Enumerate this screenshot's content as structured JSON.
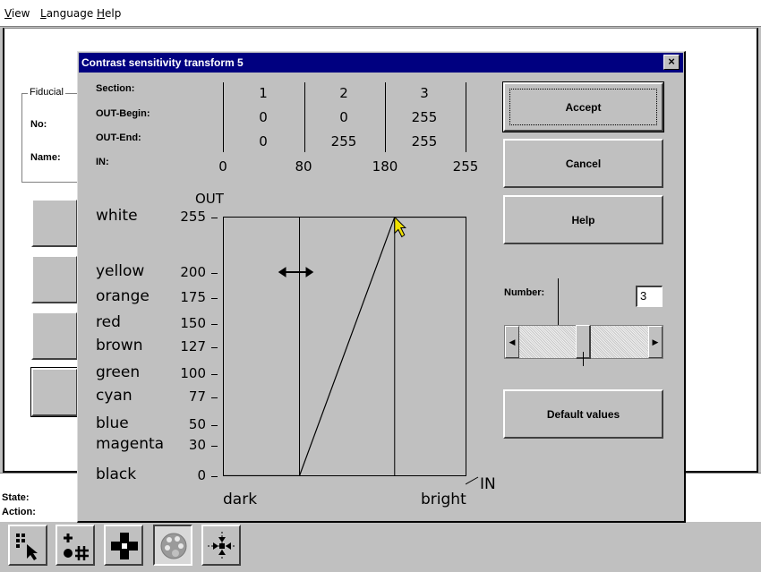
{
  "menubar": {
    "items": [
      {
        "label": "View",
        "ul": "V",
        "rest": "iew"
      },
      {
        "label": "Language",
        "ul": "L",
        "rest": "anguage"
      },
      {
        "label": "Help",
        "ul": "H",
        "rest": "elp"
      }
    ]
  },
  "background": {
    "fiducial_title": "Fiducial",
    "no_label": "No:",
    "name_label": "Name:",
    "state_label": "State:",
    "action_label": "Action:"
  },
  "dialog": {
    "title": "Contrast sensitivity transform 5",
    "close_glyph": "×",
    "table": {
      "section_label": "Section:",
      "out_begin_label": "OUT-Begin:",
      "out_end_label": "OUT-End:",
      "in_label": "IN:",
      "sections": [
        "1",
        "2",
        "3"
      ],
      "out_begin": [
        "0",
        "0",
        "255"
      ],
      "out_end": [
        "0",
        "255",
        "255"
      ],
      "in_breaks": [
        "0",
        "80",
        "180",
        "255"
      ]
    },
    "buttons": {
      "accept": "Accept",
      "cancel": "Cancel",
      "help": "Help",
      "default_values": "Default values"
    },
    "number_label": "Number:",
    "number_value": "3",
    "slider_level": 0.5
  },
  "chart_data": {
    "type": "line",
    "ylabel": "OUT",
    "xlabel": "IN",
    "x_start_label": "dark",
    "x_end_label": "bright",
    "xlim": [
      0,
      255
    ],
    "ylim": [
      0,
      255
    ],
    "y_ticks": [
      {
        "name": "white",
        "value": 255
      },
      {
        "name": "yellow",
        "value": 200
      },
      {
        "name": "orange",
        "value": 175
      },
      {
        "name": "red",
        "value": 150
      },
      {
        "name": "brown",
        "value": 127
      },
      {
        "name": "green",
        "value": 100
      },
      {
        "name": "cyan",
        "value": 77
      },
      {
        "name": "blue",
        "value": 50
      },
      {
        "name": "magenta",
        "value": 30
      },
      {
        "name": "black",
        "value": 0
      }
    ],
    "section_boundaries": [
      80,
      180
    ],
    "points": [
      [
        0,
        0
      ],
      [
        80,
        0
      ],
      [
        180,
        255
      ],
      [
        255,
        255
      ]
    ]
  },
  "toolbar": {
    "tools": [
      {
        "icon": "select-arrow-icon"
      },
      {
        "icon": "add-points-icon"
      },
      {
        "icon": "move-cross-icon"
      },
      {
        "icon": "palette-icon"
      },
      {
        "icon": "fit-center-icon"
      }
    ]
  }
}
